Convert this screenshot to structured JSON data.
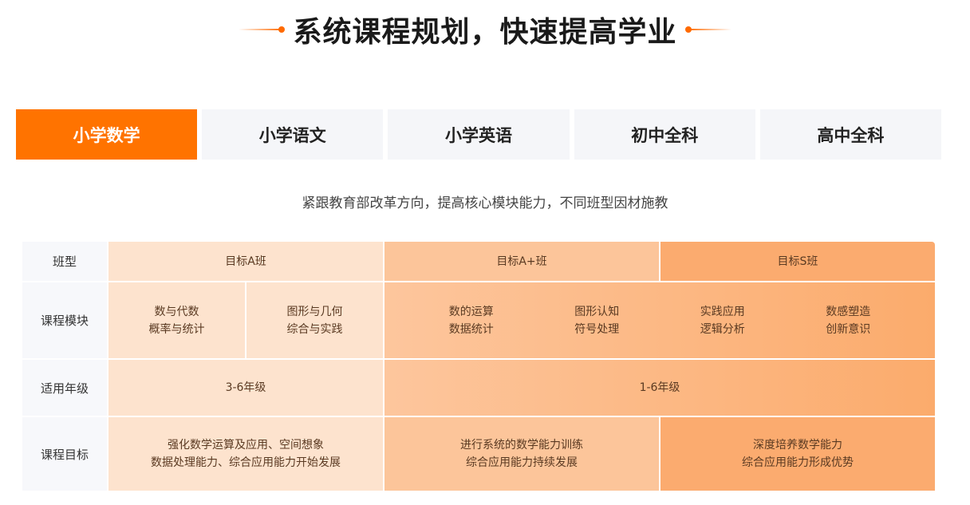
{
  "header": {
    "title": "系统课程规划，快速提高学业"
  },
  "tabs": [
    {
      "label": "小学数学",
      "active": true
    },
    {
      "label": "小学语文",
      "active": false
    },
    {
      "label": "小学英语",
      "active": false
    },
    {
      "label": "初中全科",
      "active": false
    },
    {
      "label": "高中全科",
      "active": false
    }
  ],
  "subtitle": "紧跟教育部改革方向，提高核心模块能力，不同班型因材施教",
  "table": {
    "row_labels": {
      "class_type": "班型",
      "modules": "课程模块",
      "grades": "适用年级",
      "goals": "课程目标"
    },
    "class_types": [
      "目标A班",
      "目标A+班",
      "目标S班"
    ],
    "modules_a": [
      {
        "line1": "数与代数",
        "line2": "概率与统计"
      },
      {
        "line1": "图形与几何",
        "line2": "综合与实践"
      }
    ],
    "modules_b": [
      {
        "line1": "数的运算",
        "line2": "数据统计"
      },
      {
        "line1": "图形认知",
        "line2": "符号处理"
      },
      {
        "line1": "实践应用",
        "line2": "逻辑分析"
      },
      {
        "line1": "数感塑造",
        "line2": "创新意识"
      }
    ],
    "grades": {
      "a": "3-6年级",
      "b": "1-6年级"
    },
    "goals": [
      {
        "line1": "强化数学运算及应用、空间想象",
        "line2": "数据处理能力、综合应用能力开始发展"
      },
      {
        "line1": "进行系统的数学能力训练",
        "line2": "综合应用能力持续发展"
      },
      {
        "line1": "深度培养数学能力",
        "line2": "综合应用能力形成优势"
      }
    ]
  },
  "colors": {
    "accent": "#ff7300",
    "tab_bg": "#f5f6f9",
    "col_a": "#fde3ce",
    "col_aa": "#fcc59a",
    "col_s": "#fbab6f"
  }
}
